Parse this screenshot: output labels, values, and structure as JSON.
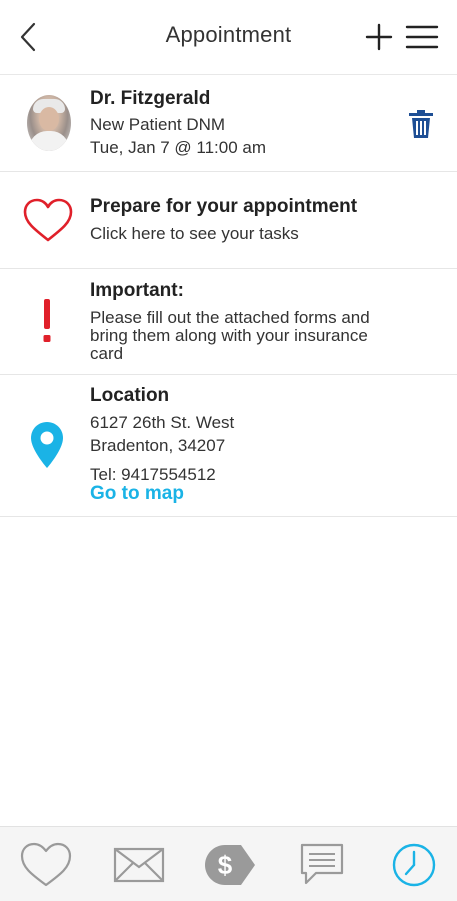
{
  "header": {
    "title": "Appointment",
    "back_icon": "chevron-left-icon",
    "add_icon": "plus-icon",
    "menu_icon": "hamburger-menu-icon"
  },
  "appointment": {
    "doctor_name": "Dr. Fitzgerald",
    "visit_type": "New Patient DNM",
    "datetime": "Tue, Jan 7 @ 11:00 am",
    "delete_icon": "trash-icon"
  },
  "prepare": {
    "title": "Prepare for your appointment",
    "subtitle": "Click here to see your tasks",
    "icon": "heart-outline-icon"
  },
  "important": {
    "title": "Important:",
    "line1": "Please fill out the attached forms and",
    "line2": "bring them along with your insurance",
    "line3": "card",
    "icon": "exclamation-icon"
  },
  "location": {
    "title": "Location",
    "address1": "6127 26th St. West",
    "address2": "Bradenton, 34207",
    "phone": "Tel: 9417554512",
    "map_link": "Go to map",
    "icon": "map-pin-icon"
  },
  "bottom_nav": {
    "items": [
      "heart-icon",
      "mail-icon",
      "dollar-tag-icon",
      "chat-icon",
      "clock-icon"
    ],
    "active_item": "clock-icon"
  },
  "colors": {
    "accent_blue": "#1ab3e6",
    "heart_red": "#e0202a",
    "trash_blue": "#1e4f95",
    "nav_gray": "#9a9a9a"
  }
}
